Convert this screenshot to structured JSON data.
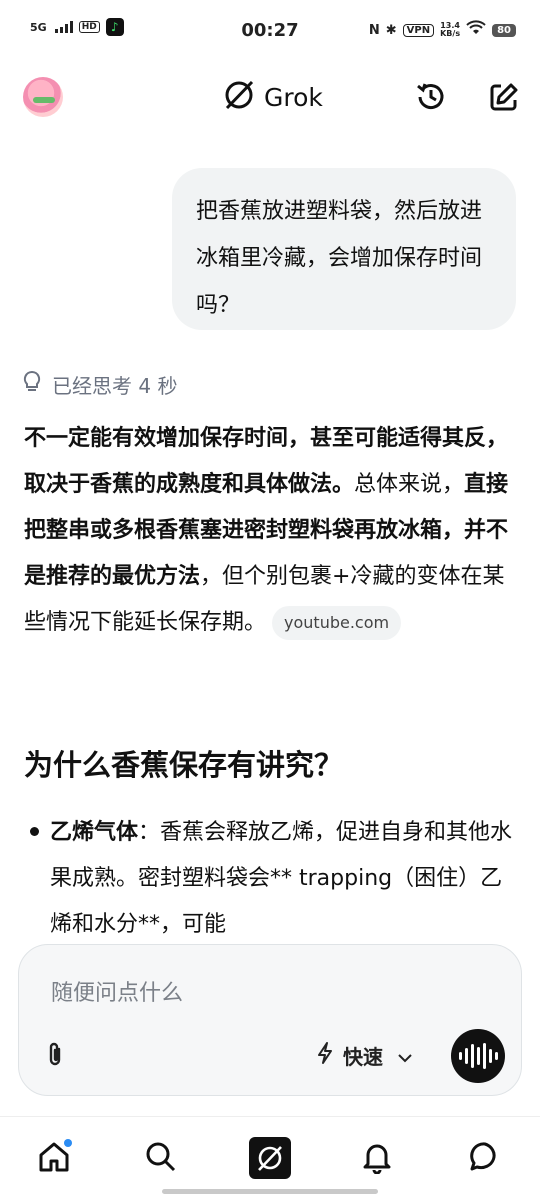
{
  "status_bar": {
    "network": "5G",
    "hd": "HD",
    "time": "00:27",
    "nfc": "N",
    "bluetooth": "✱",
    "vpn": "VPN",
    "speed_value": "13.4",
    "speed_unit": "KB/s",
    "battery": "80"
  },
  "header": {
    "brand": "Grok"
  },
  "conversation": {
    "user_message": "把香蕉放进塑料袋，然后放进冰箱里冷藏，会增加保存时间吗？",
    "thinking": "已经思考 4 秒",
    "answer_parts": {
      "p1_bold": "不一定能有效增加保存时间，甚至可能适得其反，取决于香蕉的成熟度和具体做法。",
      "p2": "总体来说，",
      "p3_bold": "直接把整串或多根香蕉塞进密封塑料袋再放冰箱，并不是推荐的最优方法",
      "p4": "，但个别包裹+冷藏的变体在某些情况下能延长保存期。"
    },
    "source": "youtube.com",
    "section_heading": "为什么香蕉保存有讲究？",
    "bullet_bold": "乙烯气体",
    "bullet_text": "：香蕉会释放乙烯，促进自身和其他水果成熟。密封塑料袋会** trapping（困住）乙烯和水分**，可能"
  },
  "composer": {
    "placeholder": "随便问点什么",
    "mode": "快速"
  },
  "colors": {
    "accent_badge": "#2b8cf3",
    "bubble_bg": "#f1f3f4",
    "muted_text": "#6b7280"
  },
  "icons": [
    "history-icon",
    "compose-icon",
    "lightbulb-icon",
    "paperclip-icon",
    "lightning-icon",
    "chevron-down-icon",
    "voice-wave-icon",
    "home-icon",
    "search-icon",
    "grok-icon",
    "bell-icon",
    "chat-icon"
  ]
}
